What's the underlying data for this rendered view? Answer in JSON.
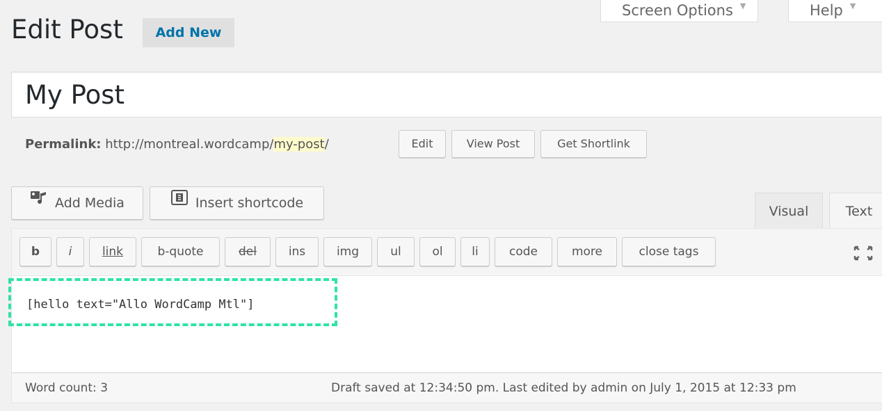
{
  "header": {
    "screen_options": "Screen Options",
    "help": "Help",
    "page_title": "Edit Post",
    "add_new": "Add New"
  },
  "post": {
    "title": "My Post",
    "permalink_label": "Permalink:",
    "permalink_base": "http://montreal.wordcamp/",
    "permalink_slug": "my-post",
    "permalink_trailing": "/",
    "buttons": {
      "edit": "Edit",
      "view_post": "View Post",
      "get_shortlink": "Get Shortlink"
    }
  },
  "media_buttons": {
    "add_media": "Add Media",
    "insert_shortcode": "Insert shortcode"
  },
  "editor_tabs": {
    "visual": "Visual",
    "text": "Text",
    "active": "Text"
  },
  "quicktags": [
    "b",
    "i",
    "link",
    "b-quote",
    "del",
    "ins",
    "img",
    "ul",
    "ol",
    "li",
    "code",
    "more",
    "close tags"
  ],
  "editor": {
    "content": "[hello text=\"Allo WordCamp Mtl\"]"
  },
  "status": {
    "word_count": "Word count: 3",
    "saved": "Draft saved at 12:34:50 pm. Last edited by admin on July 1, 2015 at 12:33 pm"
  },
  "colors": {
    "link": "#0073aa",
    "highlight": "#2fe3a4",
    "slug_bg": "#fffbcc"
  }
}
